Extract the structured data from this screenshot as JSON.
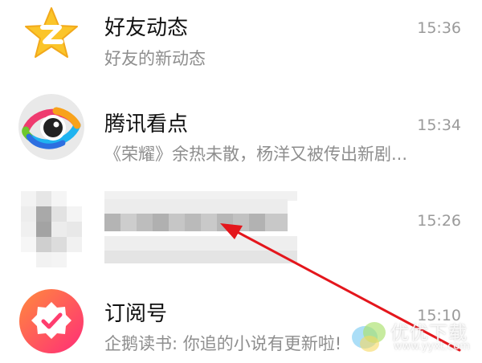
{
  "chats": [
    {
      "title": "好友动态",
      "subtitle": "好友的新动态",
      "time": "15:36",
      "icon": "qzone-star-icon"
    },
    {
      "title": "腾讯看点",
      "subtitle": "《荣耀》余热未散，杨洋又被传出新剧...",
      "time": "15:34",
      "icon": "eye-icon"
    },
    {
      "title": "",
      "subtitle": "",
      "time": "15:26",
      "icon": "blurred-avatar"
    },
    {
      "title": "订阅号",
      "subtitle": "企鹅读书: 你追的小说有更新啦!",
      "time": "15:10",
      "icon": "subscription-badge-icon"
    }
  ],
  "colors": {
    "annotation_arrow": "#e4161c",
    "qzone_star": "#fbc52a",
    "subscription": "#ff3d6e"
  },
  "watermark": {
    "text": "优优下载",
    "url": "www.yyxt.com"
  }
}
